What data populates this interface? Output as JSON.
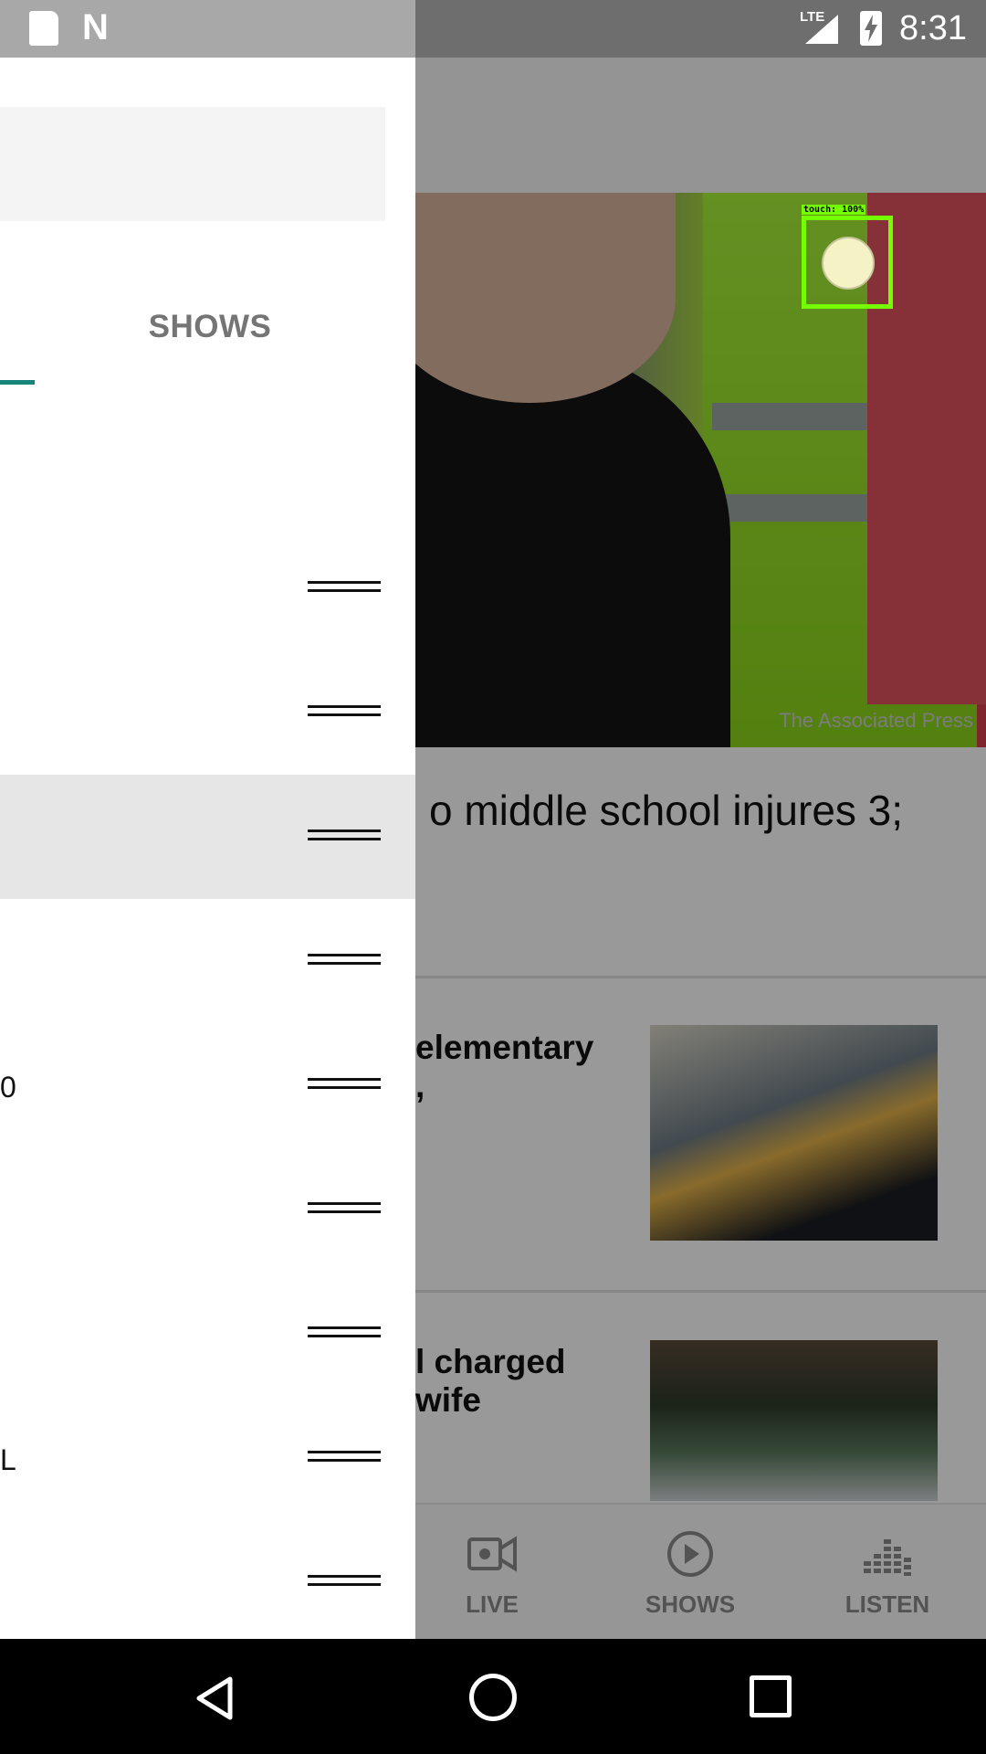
{
  "status_bar": {
    "time": "8:31",
    "network": "LTE",
    "icons": [
      "sd-card-icon",
      "n-notification-icon",
      "signal-icon",
      "battery-charging-icon"
    ]
  },
  "drawer": {
    "tabs": [
      {
        "label": "SHOWS"
      }
    ],
    "items": [
      {
        "label": "",
        "active": false
      },
      {
        "label": "",
        "active": false
      },
      {
        "label": "",
        "active": true
      },
      {
        "label": "",
        "active": false
      },
      {
        "label": "0",
        "active": false
      },
      {
        "label": "",
        "active": false
      },
      {
        "label": "",
        "active": false
      },
      {
        "label": "L",
        "active": false
      },
      {
        "label": "",
        "active": false
      }
    ]
  },
  "background_app": {
    "hero": {
      "credit": "The Associated Press",
      "touch_label": "touch: 100%"
    },
    "headline": "o middle school injures 3;",
    "stories": [
      {
        "title_line1": "elementary",
        "title_line2": ","
      },
      {
        "title_line1": "l charged",
        "title_line2": "wife"
      }
    ],
    "bottom_nav": [
      {
        "label": "LIVE",
        "icon": "video-camera-icon"
      },
      {
        "label": "SHOWS",
        "icon": "play-circle-icon"
      },
      {
        "label": "LISTEN",
        "icon": "equalizer-icon"
      }
    ]
  },
  "system_nav": {
    "icons": [
      "back-icon",
      "home-icon",
      "recents-icon"
    ]
  },
  "colors": {
    "accent": "#17857a",
    "scrim": "#000000",
    "touch_box": "#74ff00"
  }
}
